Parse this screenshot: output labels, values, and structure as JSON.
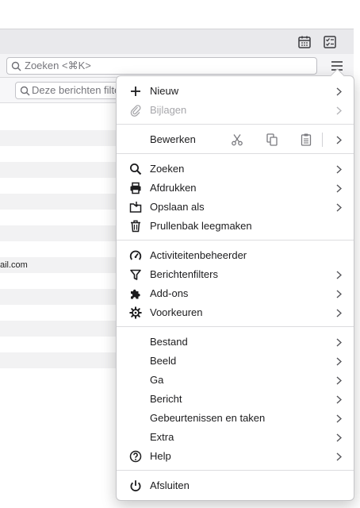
{
  "toolbar": {
    "search_placeholder": "Zoeken <⌘K>",
    "filter_placeholder": "Deze berichten filteren"
  },
  "message_list": {
    "rows": [
      "",
      "",
      "",
      "",
      "",
      "",
      "",
      "",
      "",
      "ail.com",
      "",
      "",
      "",
      "",
      "",
      ""
    ]
  },
  "menu": {
    "new": "Nieuw",
    "attachments": "Bijlagen",
    "edit": "Bewerken",
    "search": "Zoeken",
    "print": "Afdrukken",
    "save_as": "Opslaan als",
    "empty_trash": "Prullenbak leegmaken",
    "activity_manager": "Activiteitenbeheerder",
    "message_filters": "Berichtenfilters",
    "addons": "Add-ons",
    "preferences": "Voorkeuren",
    "file": "Bestand",
    "view": "Beeld",
    "go": "Ga",
    "message": "Bericht",
    "events_tasks": "Gebeurtenissen en taken",
    "tools": "Extra",
    "help": "Help",
    "quit": "Afsluiten"
  },
  "icons": {
    "calendar": "calendar-icon",
    "tasks": "tasks-icon",
    "hamburger": "hamburger-menu-icon"
  }
}
